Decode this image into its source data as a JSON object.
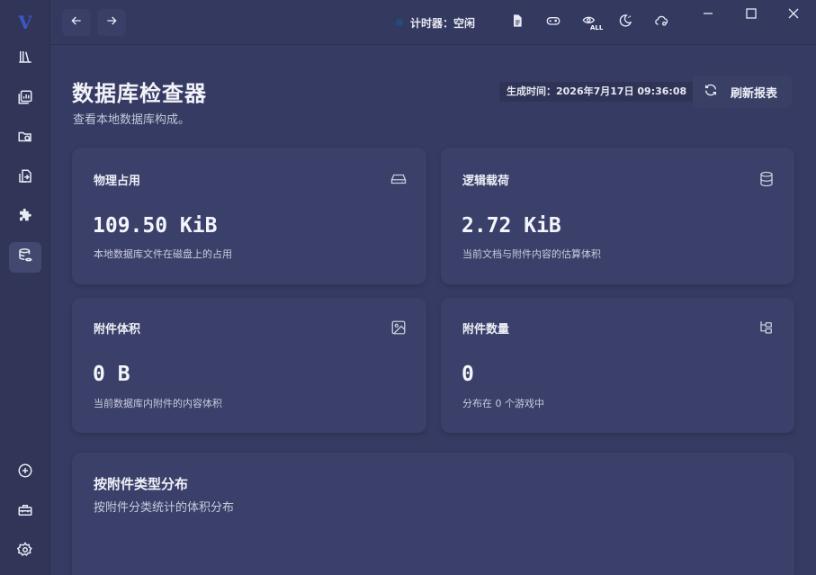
{
  "app": {
    "logo_letter": "V"
  },
  "sidebar": {
    "items": [
      {
        "icon": "library-icon"
      },
      {
        "icon": "chart-icon"
      },
      {
        "icon": "folder-search-icon"
      },
      {
        "icon": "file-import-icon"
      },
      {
        "icon": "puzzle-icon"
      },
      {
        "icon": "database-eye-icon",
        "active": true
      },
      {
        "icon": "add-circle-icon"
      },
      {
        "icon": "toolbox-icon"
      },
      {
        "icon": "gear-icon"
      }
    ]
  },
  "titlebar": {
    "timer_label": "计时器：空闲",
    "eye_badge": "ALL"
  },
  "page": {
    "title": "数据库检查器",
    "subtitle": "查看本地数据库构成。",
    "generated_time": "生成时间：2026年7月17日 09:36:08",
    "refresh_label": "刷新报表"
  },
  "cards": [
    {
      "label": "物理占用",
      "value": "109.50 KiB",
      "desc": "本地数据库文件在磁盘上的占用",
      "icon": "hard-drive-icon"
    },
    {
      "label": "逻辑载荷",
      "value": "2.72 KiB",
      "desc": "当前文档与附件内容的估算体积",
      "icon": "database-icon"
    },
    {
      "label": "附件体积",
      "value": "0 B",
      "desc": "当前数据库内附件的内容体积",
      "icon": "image-icon"
    },
    {
      "label": "附件数量",
      "value": "0",
      "desc": "分布在 0 个游戏中",
      "icon": "tree-icon"
    }
  ],
  "distribution": {
    "title": "按附件类型分布",
    "subtitle": "按附件分类统计的体积分布"
  },
  "colors": {
    "background": "#363b63",
    "card": "#3b406a",
    "accent": "#3f56c9"
  }
}
